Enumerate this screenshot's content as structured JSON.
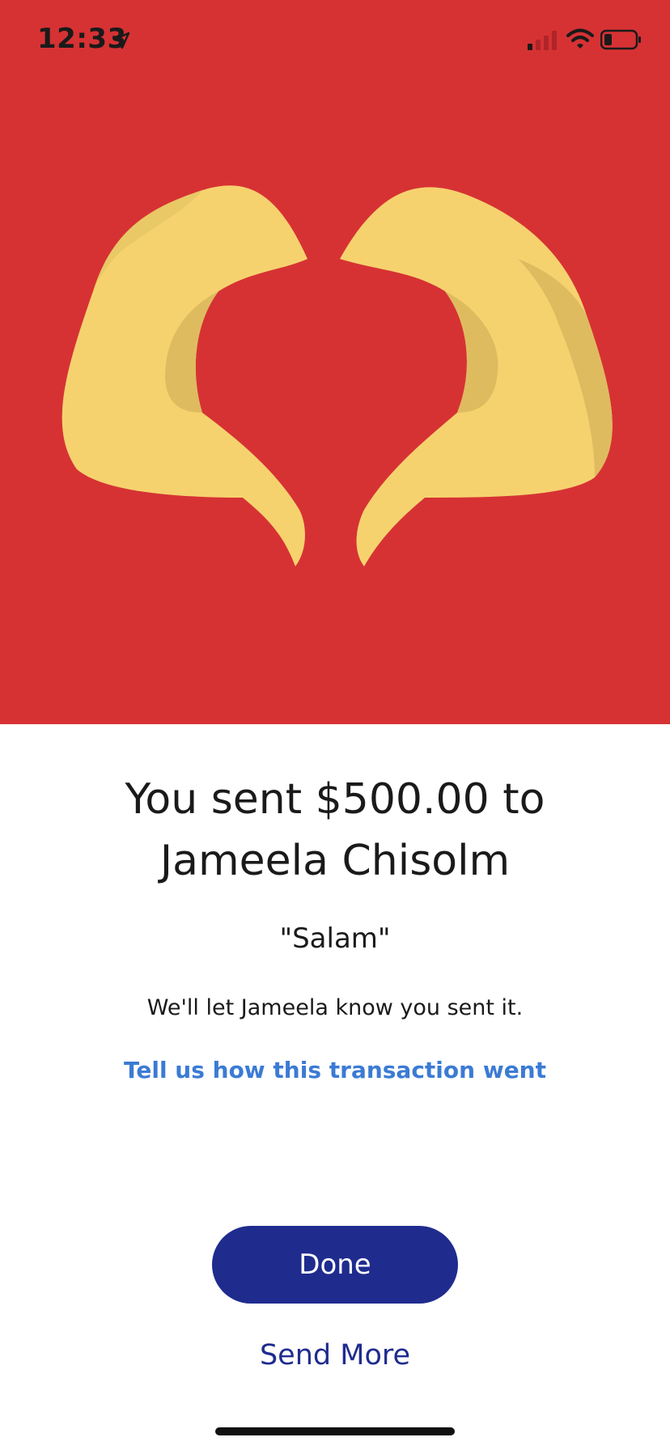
{
  "status_bar": {
    "time": "12:33",
    "icons": [
      "location-arrow-icon",
      "cellular-signal-icon",
      "wifi-icon",
      "battery-icon"
    ]
  },
  "hero": {
    "background_color": "#d63234",
    "illustration": "heart-hands-icon"
  },
  "confirmation": {
    "title_line1": "You sent $500.00 to",
    "title_line2": "Jameela Chisolm",
    "note": "\"Salam\"",
    "info": "We'll let Jameela know you sent it.",
    "feedback_link": "Tell us how this transaction went"
  },
  "actions": {
    "done_label": "Done",
    "send_more_label": "Send More"
  },
  "colors": {
    "primary": "#1f2c8e",
    "link": "#3b7bd4"
  }
}
